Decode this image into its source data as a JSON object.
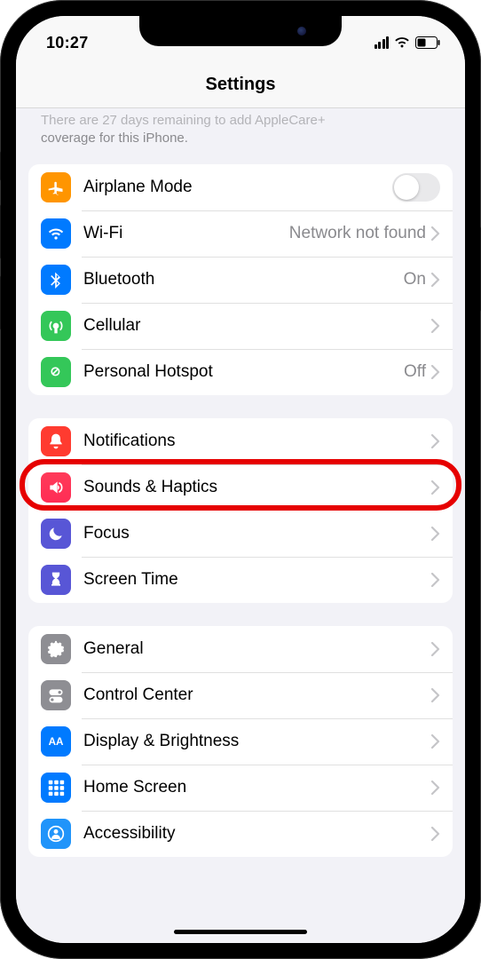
{
  "status": {
    "time": "10:27"
  },
  "header": {
    "title": "Settings"
  },
  "banner": {
    "line1": "There are 27 days remaining to add AppleCare+",
    "line2": "coverage for this iPhone."
  },
  "group_connectivity": [
    {
      "id": "airplane",
      "label": "Airplane Mode",
      "value": "",
      "control": "toggle",
      "icon": "plane",
      "bg": "bg-orange"
    },
    {
      "id": "wifi",
      "label": "Wi-Fi",
      "value": "Network not found",
      "control": "link",
      "icon": "wifi",
      "bg": "bg-blue"
    },
    {
      "id": "bluetooth",
      "label": "Bluetooth",
      "value": "On",
      "control": "link",
      "icon": "bt",
      "bg": "bg-blue"
    },
    {
      "id": "cellular",
      "label": "Cellular",
      "value": "",
      "control": "link",
      "icon": "antenna",
      "bg": "bg-green"
    },
    {
      "id": "hotspot",
      "label": "Personal Hotspot",
      "value": "Off",
      "control": "link",
      "icon": "link",
      "bg": "bg-green"
    }
  ],
  "group_notifications": [
    {
      "id": "notifications",
      "label": "Notifications",
      "icon": "bell",
      "bg": "bg-red"
    },
    {
      "id": "sounds",
      "label": "Sounds & Haptics",
      "icon": "speaker",
      "bg": "bg-pink",
      "highlighted": true
    },
    {
      "id": "focus",
      "label": "Focus",
      "icon": "moon",
      "bg": "bg-indigo"
    },
    {
      "id": "screentime",
      "label": "Screen Time",
      "icon": "hourglass",
      "bg": "bg-indigo"
    }
  ],
  "group_general": [
    {
      "id": "general",
      "label": "General",
      "icon": "gear",
      "bg": "bg-gray"
    },
    {
      "id": "controlcenter",
      "label": "Control Center",
      "icon": "switches",
      "bg": "bg-gray"
    },
    {
      "id": "display",
      "label": "Display & Brightness",
      "icon": "aa",
      "bg": "bg-blue"
    },
    {
      "id": "homescreen",
      "label": "Home Screen",
      "icon": "grid",
      "bg": "bg-bluegrid"
    },
    {
      "id": "accessibility",
      "label": "Accessibility",
      "icon": "person",
      "bg": "bg-lightblue"
    }
  ]
}
